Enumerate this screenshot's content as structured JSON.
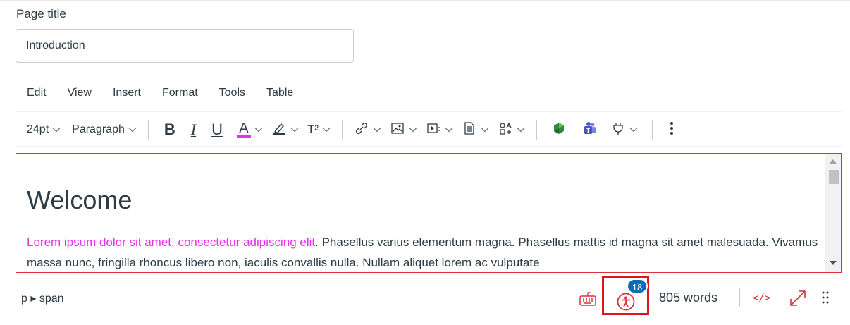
{
  "title_field": {
    "label": "Page title",
    "value": "Introduction"
  },
  "menubar": {
    "items": [
      "Edit",
      "View",
      "Insert",
      "Format",
      "Tools",
      "Table"
    ]
  },
  "toolbar": {
    "font_size": "24pt",
    "block_format": "Paragraph",
    "bold_label": "B",
    "italic_label": "I",
    "underline_label": "U",
    "text_color_label": "A",
    "superscript_label": "T²",
    "accent_text_color": "#e830e8"
  },
  "editor": {
    "heading": "Welcome",
    "para_highlight": "Lorem ipsum dolor sit amet, consectetur adipiscing elit",
    "para_rest": ". Phasellus varius elementum magna. Phasellus mattis id magna sit amet malesuada. Vivamus massa nunc, fringilla rhoncus libero non, iaculis convallis nulla. Nullam aliquet lorem ac vulputate"
  },
  "statusbar": {
    "path": "p ▸ span",
    "a11y_count": "18",
    "word_count": "805 words",
    "code_label": "</>"
  },
  "colors": {
    "error_red": "#d7343b",
    "badge_blue": "#0a6cb7",
    "highlight_pink": "#e830e8"
  }
}
